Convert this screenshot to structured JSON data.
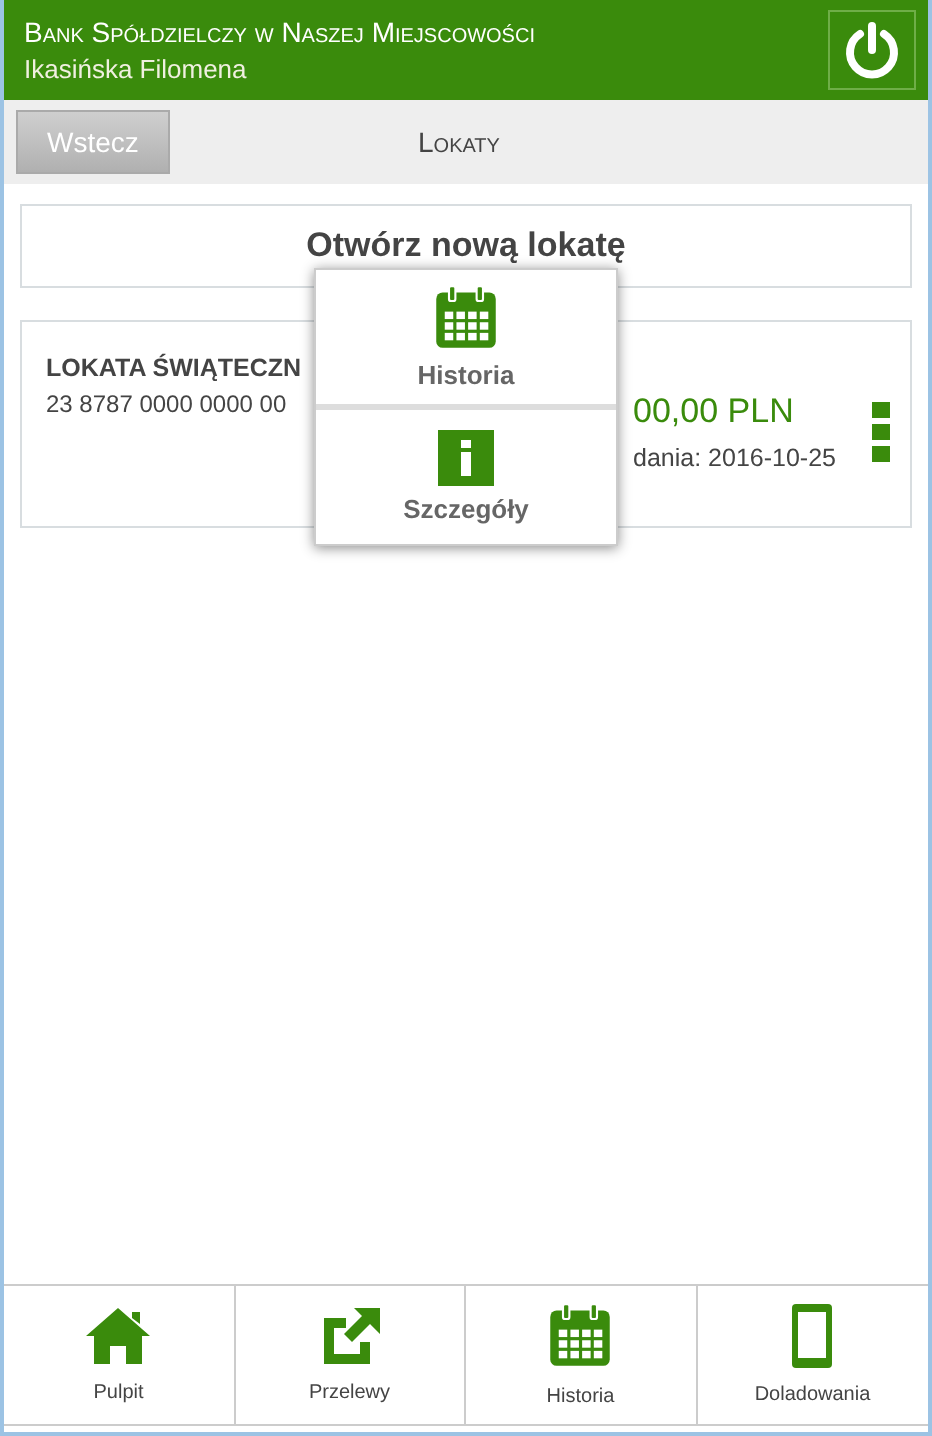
{
  "header": {
    "bank_name": "Bank Spółdzielczy w Naszej Miejscowości",
    "user_name": "Ikasińska Filomena"
  },
  "subheader": {
    "back_button": "Wstecz",
    "title": "Lokaty"
  },
  "open_deposit_button": "Otwórz nową lokatę",
  "deposits": [
    {
      "name": "LOKATA ŚWIĄTECZN",
      "account": "23 8787 0000 0000 00",
      "amount": "00,00 PLN",
      "date": "dania: 2016-10-25"
    }
  ],
  "context_menu": [
    {
      "label": "Historia",
      "kind": "calendar"
    },
    {
      "label": "Szczegóły",
      "kind": "info"
    }
  ],
  "bottom_nav": [
    {
      "label": "Pulpit",
      "kind": "home"
    },
    {
      "label": "Przelewy",
      "kind": "transfer"
    },
    {
      "label": "Historia",
      "kind": "calendar"
    },
    {
      "label": "Doladowania",
      "kind": "phone"
    }
  ]
}
